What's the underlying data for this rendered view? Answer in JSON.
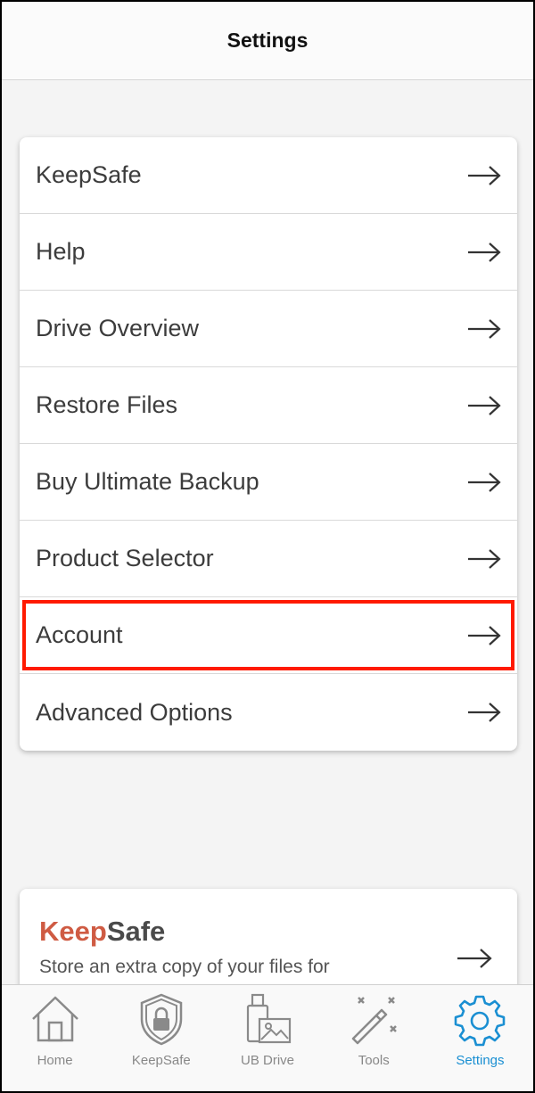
{
  "header": {
    "title": "Settings"
  },
  "menu": {
    "items": [
      {
        "label": "KeepSafe"
      },
      {
        "label": "Help"
      },
      {
        "label": "Drive Overview"
      },
      {
        "label": "Restore Files"
      },
      {
        "label": "Buy Ultimate Backup"
      },
      {
        "label": "Product Selector"
      },
      {
        "label": "Account",
        "highlighted": true
      },
      {
        "label": "Advanced Options"
      }
    ]
  },
  "promo": {
    "title_keep": "Keep",
    "title_safe": "Safe",
    "text": "Store an extra copy of your files for"
  },
  "tabbar": {
    "items": [
      {
        "label": "Home",
        "icon": "home-icon"
      },
      {
        "label": "KeepSafe",
        "icon": "shield-lock-icon"
      },
      {
        "label": "UB Drive",
        "icon": "drive-icon"
      },
      {
        "label": "Tools",
        "icon": "magic-wand-icon"
      },
      {
        "label": "Settings",
        "icon": "gear-icon",
        "active": true
      }
    ]
  },
  "colors": {
    "accent": "#1a8fd2",
    "highlight": "#ff1a00",
    "brand_keep": "#cf5b43"
  }
}
